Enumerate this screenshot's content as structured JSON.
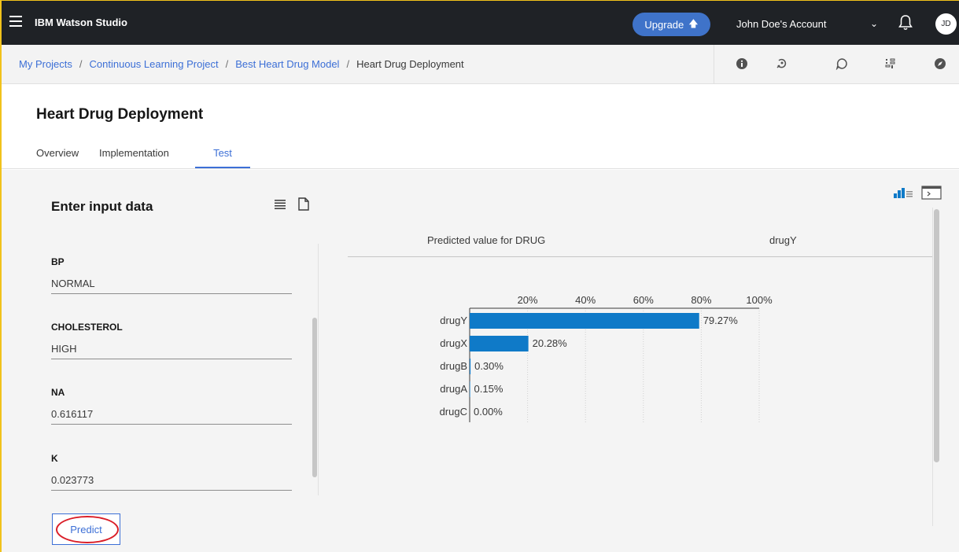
{
  "topbar": {
    "brand": "IBM Watson Studio",
    "upgrade_label": "Upgrade",
    "account_label": "John Doe's Account",
    "avatar_initials": "JD"
  },
  "breadcrumb": {
    "items": [
      "My Projects",
      "Continuous Learning Project",
      "Best Heart Drug Model"
    ],
    "separator": "/",
    "current": "Heart Drug Deployment"
  },
  "page": {
    "title": "Heart Drug Deployment",
    "tabs": [
      {
        "label": "Overview"
      },
      {
        "label": "Implementation"
      },
      {
        "label": "Test"
      }
    ],
    "active_tab": "Test"
  },
  "input_panel": {
    "title": "Enter input data",
    "fields": [
      {
        "label": "BP",
        "value": "NORMAL"
      },
      {
        "label": "CHOLESTEROL",
        "value": "HIGH"
      },
      {
        "label": "NA",
        "value": "0.616117"
      },
      {
        "label": "K",
        "value": "0.023773"
      }
    ],
    "predict_label": "Predict"
  },
  "result": {
    "label": "Predicted value for DRUG",
    "value": "drugY"
  },
  "colors": {
    "topbar": "#1f2226",
    "accent": "#3c6fd6",
    "bar": "#0f7ac8",
    "highlight_ring": "#da1e28",
    "frame": "#f1c21b"
  },
  "chart_data": {
    "type": "bar",
    "orientation": "horizontal",
    "categories": [
      "drugY",
      "drugX",
      "drugB",
      "drugA",
      "drugC"
    ],
    "values": [
      79.27,
      20.28,
      0.3,
      0.15,
      0.0
    ],
    "value_labels": [
      "79.27%",
      "20.28%",
      "0.30%",
      "0.15%",
      "0.00%"
    ],
    "xlim": [
      0,
      100
    ],
    "x_ticks": [
      20,
      40,
      60,
      80,
      100
    ],
    "x_tick_labels": [
      "20%",
      "40%",
      "60%",
      "80%",
      "100%"
    ],
    "axis_position": "top",
    "grid": true
  }
}
